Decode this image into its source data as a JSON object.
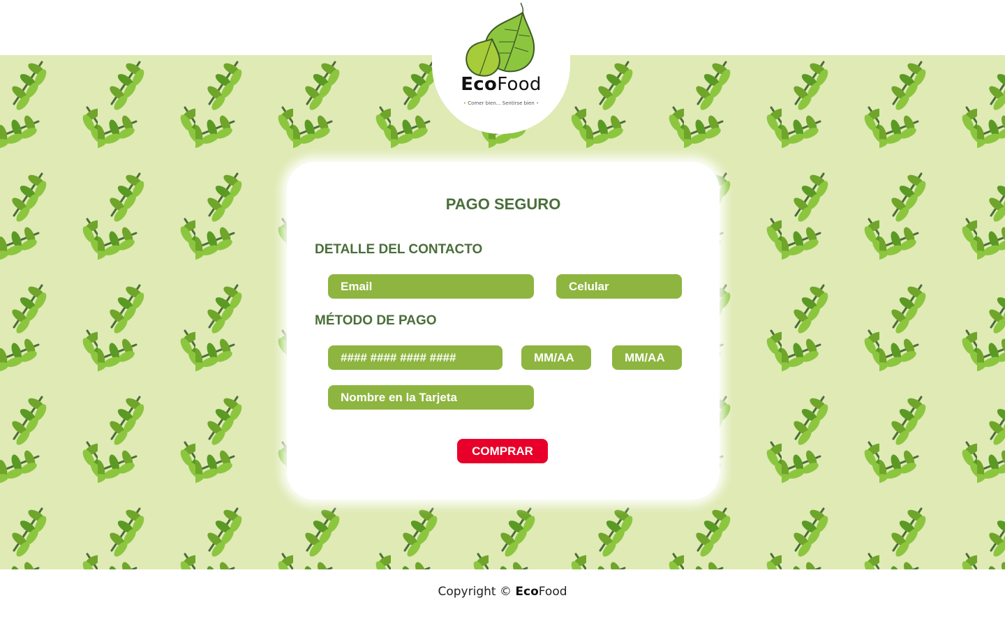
{
  "brand": {
    "name_part1": "Eco",
    "name_part2": "Food",
    "tagline": "Comer bien... Sentirse bien",
    "leaf_color": "#8db53f",
    "dark_green": "#4a6e3a"
  },
  "form": {
    "title": "PAGO SEGURO",
    "contact_section": "DETALLE DEL CONTACTO",
    "email_placeholder": "Email",
    "phone_placeholder": "Celular",
    "payment_section": "MÉTODO DE PAGO",
    "card_number_placeholder": "#### #### #### ####",
    "expiry_placeholder_1": "MM/AA",
    "expiry_placeholder_2": "MM/AA",
    "name_on_card_placeholder": "Nombre en la Tarjeta",
    "submit_label": "COMPRAR",
    "submit_color": "#e8002a",
    "field_color": "#8db53f"
  },
  "footer": {
    "copyright_prefix": "Copyright ©",
    "brand_part1": "Eco",
    "brand_part2": "Food"
  },
  "background": {
    "pattern_color": "#dfeab5",
    "icon": "leaf-branch-icon"
  }
}
